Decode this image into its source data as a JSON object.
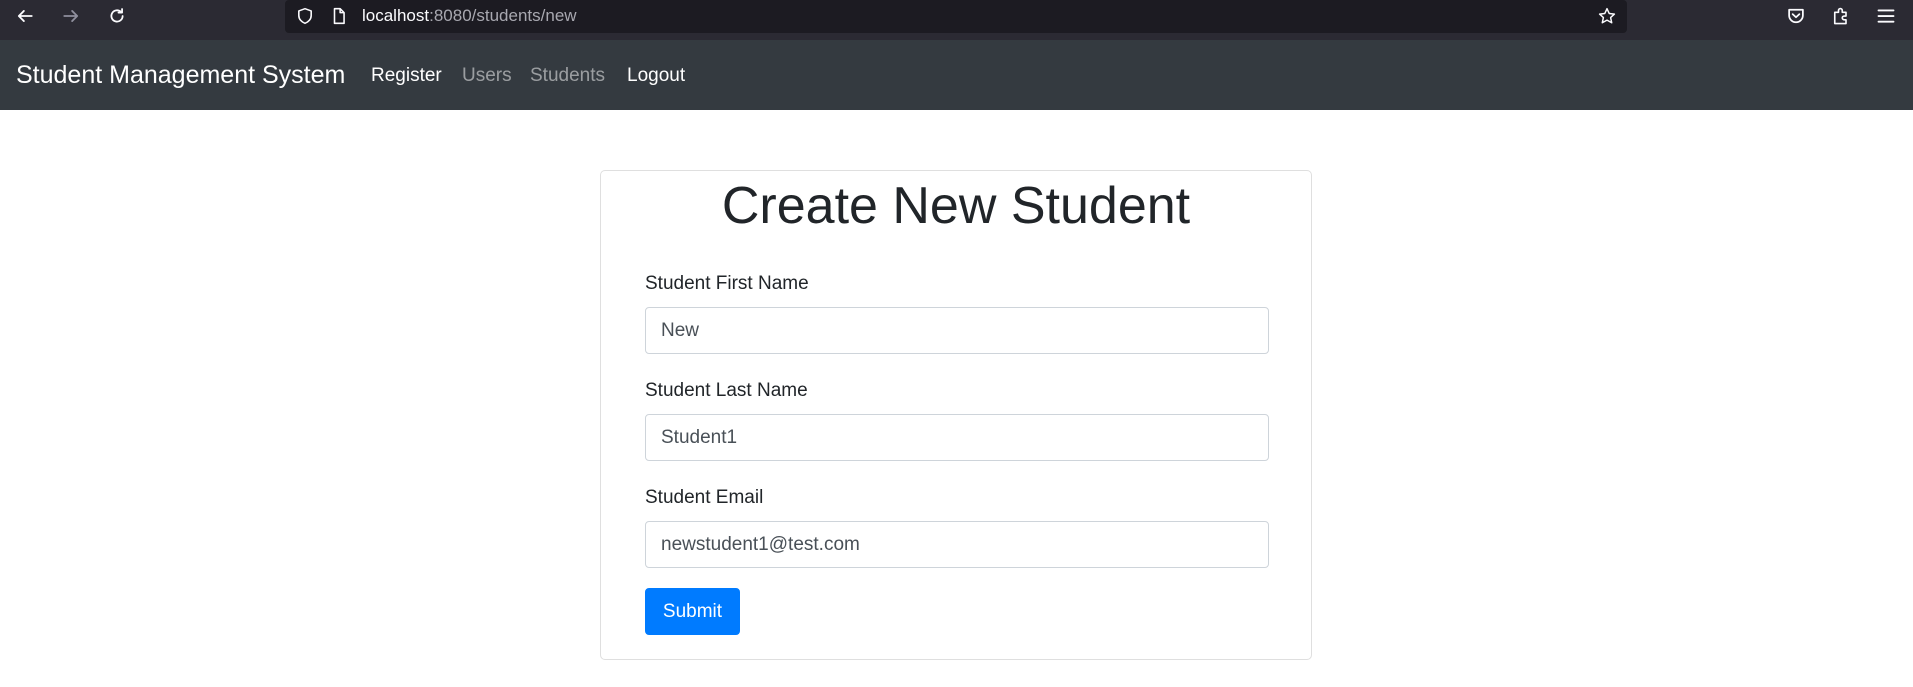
{
  "browser": {
    "url_host": "localhost",
    "url_rest": ":8080/students/new",
    "icons": [
      "back-icon",
      "forward-icon",
      "reload-icon",
      "shield-icon",
      "page-icon",
      "star-icon",
      "pocket-icon",
      "extensions-icon",
      "menu-icon"
    ]
  },
  "navbar": {
    "brand": "Student Management System",
    "links": [
      {
        "label": "Register",
        "state": "active"
      },
      {
        "label": "Users",
        "state": "muted"
      },
      {
        "label": "Students",
        "state": "muted"
      },
      {
        "label": "Logout",
        "state": "active"
      }
    ],
    "background": "#343a40"
  },
  "form": {
    "title": "Create New Student",
    "fields": [
      {
        "label": "Student First Name",
        "value": "New"
      },
      {
        "label": "Student Last Name",
        "value": "Student1"
      },
      {
        "label": "Student Email",
        "value": "newstudent1@test.com"
      }
    ],
    "submit_label": "Submit",
    "accent": "#007bff"
  }
}
